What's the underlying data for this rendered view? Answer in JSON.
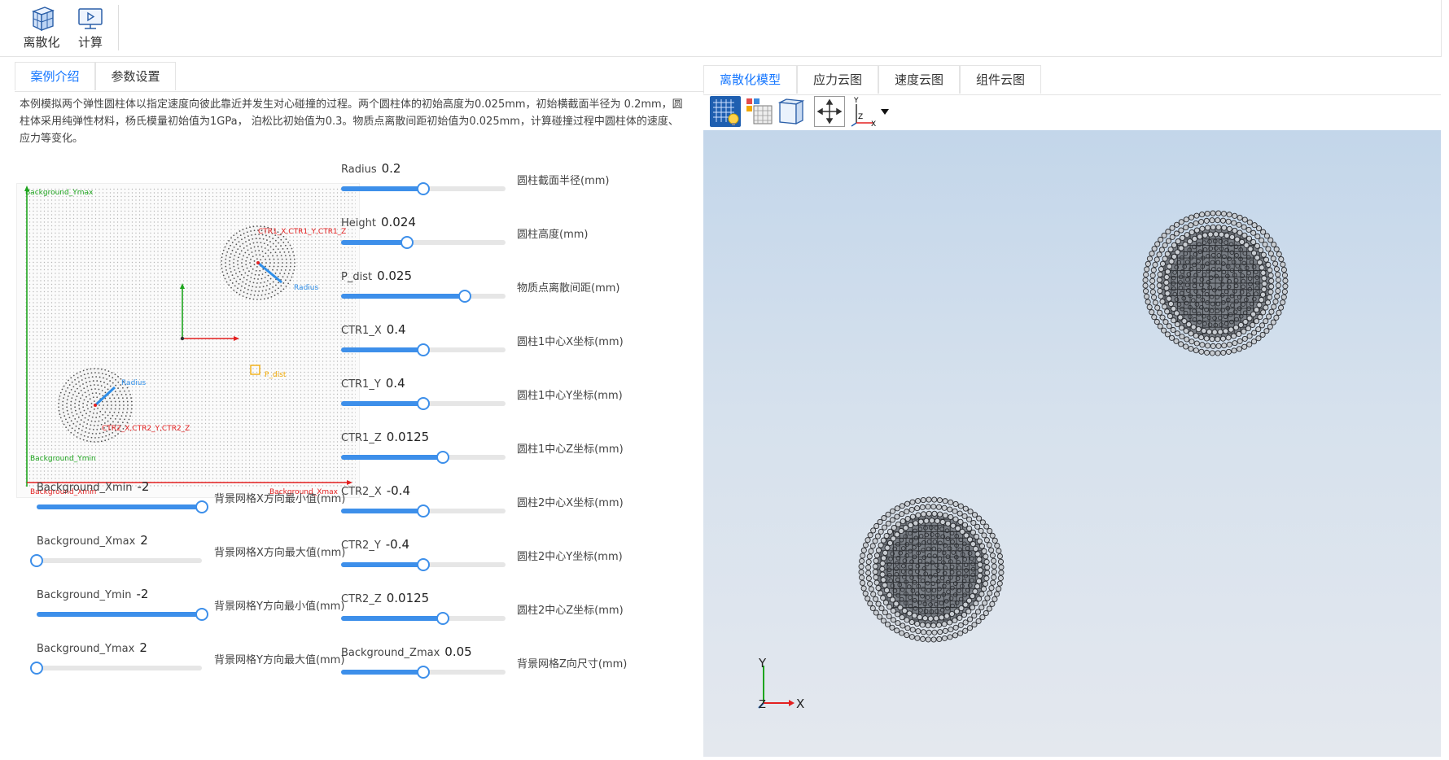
{
  "toolbar": {
    "discretize_label": "离散化",
    "compute_label": "计算"
  },
  "left_tabs": [
    {
      "label": "案例介绍",
      "active": true
    },
    {
      "label": "参数设置",
      "active": false
    }
  ],
  "intro": {
    "text": "本例模拟两个弹性圆柱体以指定速度向彼此靠近并发生对心碰撞的过程。两个圆柱体的初始高度为0.025mm，初始横截面半径为 0.2mm，圆柱体采用纯弹性材料，杨氏模量初始值为1GPa， 泊松比初始值为0.3。物质点离散间距初始值为0.025mm，计算碰撞过程中圆柱体的速度、应力等变化。"
  },
  "diagram": {
    "bg_ymax": "Background_Ymax",
    "bg_ymin": "Background_Ymin",
    "bg_xmin": "Background_Xmin",
    "bg_xmax": "Background_Xmax",
    "ctr1": "CTR1_X,CTR1_Y,CTR1_Z",
    "ctr2": "CTR2_X,CTR2_Y,CTR2_Z",
    "radius1": "Radius",
    "radius2": "Radius",
    "pdist": "P_dist"
  },
  "params_right": [
    {
      "name": "Radius",
      "value": "0.2",
      "desc": "圆柱截面半径(mm)",
      "fraction": 0.5
    },
    {
      "name": "Height",
      "value": "0.024",
      "desc": "圆柱高度(mm)",
      "fraction": 0.4
    },
    {
      "name": "P_dist",
      "value": "0.025",
      "desc": "物质点离散间距(mm)",
      "fraction": 0.75
    },
    {
      "name": "CTR1_X",
      "value": "0.4",
      "desc": "圆柱1中心X坐标(mm)",
      "fraction": 0.5
    },
    {
      "name": "CTR1_Y",
      "value": "0.4",
      "desc": "圆柱1中心Y坐标(mm)",
      "fraction": 0.5
    },
    {
      "name": "CTR1_Z",
      "value": "0.0125",
      "desc": "圆柱1中心Z坐标(mm)",
      "fraction": 0.62
    },
    {
      "name": "CTR2_X",
      "value": "-0.4",
      "desc": "圆柱2中心X坐标(mm)",
      "fraction": 0.5
    },
    {
      "name": "CTR2_Y",
      "value": "-0.4",
      "desc": "圆柱2中心Y坐标(mm)",
      "fraction": 0.5
    },
    {
      "name": "CTR2_Z",
      "value": "0.0125",
      "desc": "圆柱2中心Z坐标(mm)",
      "fraction": 0.62
    },
    {
      "name": "Background_Zmax",
      "value": "0.05",
      "desc": "背景网格Z向尺寸(mm)",
      "fraction": 0.5
    }
  ],
  "params_left": [
    {
      "name": "Background_Xmin",
      "value": "-2",
      "desc": "背景网格X方向最小值(mm)",
      "fraction": 1.0
    },
    {
      "name": "Background_Xmax",
      "value": "2",
      "desc": "背景网格X方向最大值(mm)",
      "fraction": 0.0
    },
    {
      "name": "Background_Ymin",
      "value": "-2",
      "desc": "背景网格Y方向最小值(mm)",
      "fraction": 1.0
    },
    {
      "name": "Background_Ymax",
      "value": "2",
      "desc": "背景网格Y方向最大值(mm)",
      "fraction": 0.0
    }
  ],
  "right_tabs": [
    {
      "label": "离散化模型",
      "active": true
    },
    {
      "label": "应力云图",
      "active": false
    },
    {
      "label": "速度云图",
      "active": false
    },
    {
      "label": "组件云图",
      "active": false
    }
  ],
  "view_tools": [
    "grid-bulb-icon",
    "mesh-color-icon",
    "box-view-icon",
    "fit-view-icon",
    "axes-icon"
  ],
  "axes": {
    "y": "Y",
    "z": "Z",
    "x": "X"
  },
  "axes_small": {
    "y": "Y",
    "z": "Z",
    "x": "X"
  },
  "colors": {
    "accent": "#1677ff",
    "slider": "#3d8fea"
  }
}
